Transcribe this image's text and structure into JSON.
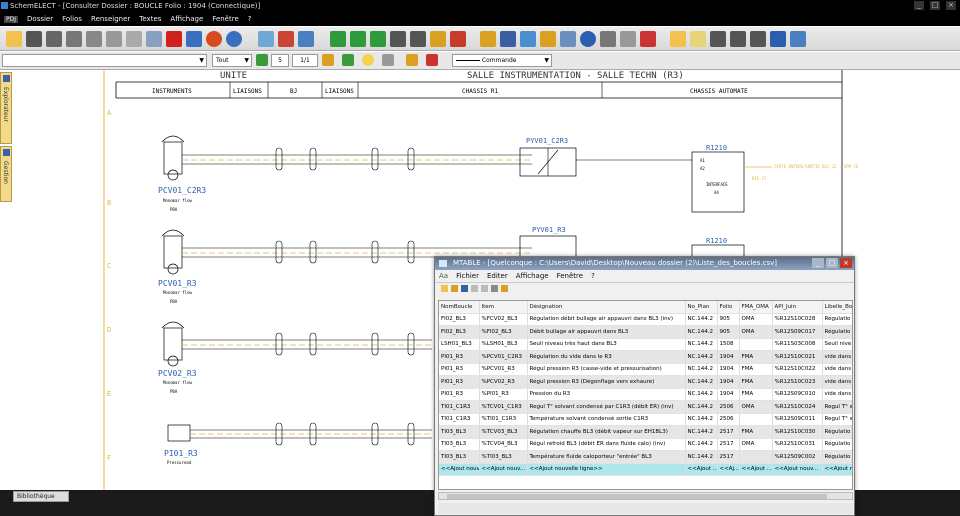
{
  "app": {
    "title": "SchemELECT - [Consulter  Dossier : BOUCLE  Folio : 1904  (Connectique)]",
    "menu": [
      "Dossier",
      "Folios",
      "Renseigner",
      "Textes",
      "Affichage",
      "Fenêtre",
      "?"
    ],
    "menu_badge": "PDJ"
  },
  "toolbar2": {
    "combo_main": "",
    "combo_filter": "Tout",
    "field_num": "5",
    "field_page": "1/1",
    "combo_cmd": "Commande"
  },
  "side_tabs": [
    "Explorateur",
    "Gestion"
  ],
  "bottom_tab": "Bibliothèque",
  "schematic": {
    "header_title_left": "UNITE",
    "header_title_right": "SALLE INSTRUMENTATION - SALLE TECHN  (R3)",
    "columns": [
      "INSTRUMENTS",
      "LIAISONS",
      "BJ",
      "LIAISONS",
      "CHASSIS R1",
      "CHASSIS AUTOMATE"
    ],
    "row_letters": [
      "A",
      "B",
      "C",
      "D",
      "E",
      "F"
    ],
    "loops": [
      {
        "tag": "PCV01_C2R3",
        "sub": "Monomar flow",
        "code": "PBA",
        "converter": "PYV01_C2R3",
        "module": "R1210"
      },
      {
        "tag": "PCV01_R3",
        "sub": "Monomar flow",
        "code": "PBA",
        "converter": "PYV01_R3",
        "module": "R1210"
      },
      {
        "tag": "PCV02_R3",
        "sub": "Monomar flow",
        "code": "PBA"
      },
      {
        "tag": "PI01_R3",
        "sub": "Pressuread"
      }
    ],
    "module_text": [
      "A1",
      "A2",
      "INTERFACE",
      "A4"
    ],
    "right_note": "CARTE ENTREE/SORTIE BLC 12 - SPM  CE",
    "right_code": "R1E-27"
  },
  "mtable": {
    "title": "MTABLE - [Quelconque : C:\\Users\\David\\Desktop\\Nouveau dossier (2)\\Liste_des_boucles.csv]",
    "menu": [
      "Fichier",
      "Editer",
      "Affichage",
      "Fenêtre",
      "?"
    ],
    "columns": [
      "NomBoucle",
      "Item",
      "Désignation",
      "No_Plan",
      "Folio",
      "FMA_OMA",
      "API_Juin",
      "Libelle_Bo"
    ],
    "rows": [
      [
        "FI02_BL3",
        "%FCV02_BL3",
        "Régulation débit bullage air appauvri dans BL3 (inv)",
        "NC.144.2",
        "905",
        "OMA",
        "%R12S10C028",
        "Régulatio"
      ],
      [
        "FI02_BL3",
        "%FI02_BL3",
        "Débit bullage air appauvri dans BL3",
        "NC.144.2",
        "905",
        "OMA",
        "%R12S09C017",
        "Régulatio"
      ],
      [
        "LSH01_BL3",
        "%LSH01_BL3",
        "Seuil niveau très haut dans BL3",
        "NC.144.2",
        "1508",
        "",
        "%R11S03C008",
        "Seuil nive"
      ],
      [
        "PI01_R3",
        "%PCV01_C2R3",
        "Régulation du vide dans le R3",
        "NC.144.2",
        "1904",
        "FMA",
        "%R12S10C021",
        "vide dans"
      ],
      [
        "PI01_R3",
        "%PCV01_R3",
        "Régul pression R3 (casse-vide et pressurisation)",
        "NC.144.2",
        "1904",
        "FMA",
        "%R12S10C022",
        "vide dans"
      ],
      [
        "PI01_R3",
        "%PCV02_R3",
        "Régul pression R3 (Dégonflage vers exhaure)",
        "NC.144.2",
        "1904",
        "FMA",
        "%R12S10C023",
        "vide dans"
      ],
      [
        "PI01_R3",
        "%PI01_R3",
        "Pression du R3",
        "NC.144.2",
        "1904",
        "FMA",
        "%R12S09C010",
        "vide dans"
      ],
      [
        "TI01_C1R3",
        "%TCV01_C1R3",
        "Regul T° solvant condensé par C1R3 (débit ER) (inv)",
        "NC.144.2",
        "2506",
        "OMA",
        "%R12S10C024",
        "Regul T° s"
      ],
      [
        "TI01_C1R3",
        "%TI01_C1R3",
        "Température solvant condensé sortie C1R3",
        "NC.144.2",
        "2506",
        "",
        "%R12S09C011",
        "Regul T° s"
      ],
      [
        "TI03_BL3",
        "%TCV03_BL3",
        "Régulation chauffe BL3 (débit vapeur sur EH1BL3)",
        "NC.144.2",
        "2517",
        "FMA",
        "%R12S10C030",
        "Régulatio"
      ],
      [
        "TI03_BL3",
        "%TCV04_BL3",
        "Régul refroid BL3 (débit ER dans fluide calo) (inv)",
        "NC.144.2",
        "2517",
        "OMA",
        "%R12S10C031",
        "Régulatio"
      ],
      [
        "TI03_BL3",
        "%TI03_BL3",
        "Température fluide caloporteur \"entrée\" BL3",
        "NC.144.2",
        "2517",
        "",
        "%R12S09C002",
        "Régulatio"
      ]
    ],
    "new_row": [
      "<<Ajout nouv...",
      "<<Ajout nouv...",
      "<<Ajout nouvelle ligne>>",
      "<<Ajout ...",
      "<<Aj...",
      "<<Ajout ...",
      "<<Ajout nouv...",
      "<<Ajout no"
    ]
  }
}
